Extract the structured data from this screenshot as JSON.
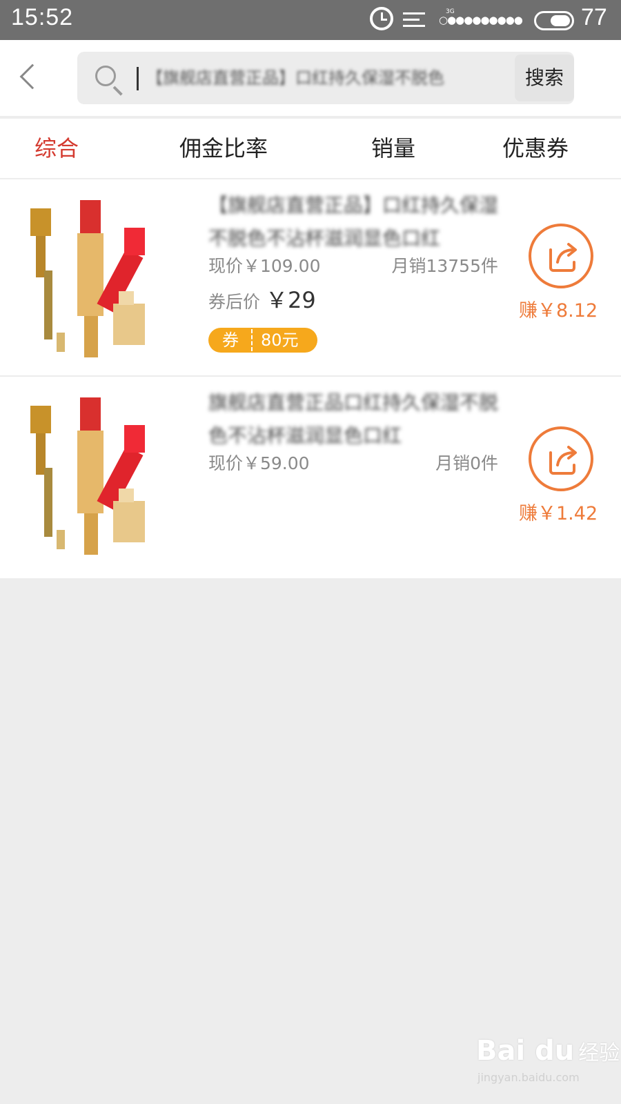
{
  "status_bar": {
    "time": "15:52",
    "network": "3G",
    "signal_dots": "○●●●●●●●●●",
    "battery": "77"
  },
  "search": {
    "value": "【旗舰店直营正品】口红持久保湿不脱色",
    "button_label": "搜索"
  },
  "sort_tabs": [
    {
      "label": "综合",
      "active": true
    },
    {
      "label": "佣金比率",
      "active": false
    },
    {
      "label": "销量",
      "active": false
    },
    {
      "label": "优惠券",
      "active": false
    }
  ],
  "products": [
    {
      "title": "【旗舰店直营正品】口红持久保湿不脱色不沾杯滋润显色口红",
      "price_now": "现价￥109.00",
      "monthly_sales": "月销13755件",
      "after_coupon_label": "券后价",
      "after_coupon_price": "￥29",
      "coupon_tag": "券",
      "coupon_value": "80元",
      "earn": "赚￥8.12"
    },
    {
      "title": "旗舰店直营正品口红持久保湿不脱色不沾杯滋润显色口红",
      "price_now": "现价￥59.00",
      "monthly_sales": "月销0件",
      "earn": "赚￥1.42"
    }
  ],
  "watermark": {
    "logo": "Bai du",
    "cn": "经验",
    "url": "jingyan.baidu.com"
  },
  "colors": {
    "accent_red": "#d43a2f",
    "earn_orange": "#ee7b3a",
    "coupon_yellow": "#f6a81c",
    "status_bar_bg": "#6f6f6f"
  },
  "icons": [
    "back-icon",
    "search-icon",
    "alarm-icon",
    "menu-icon",
    "share-icon",
    "lipstick-thumbnail"
  ]
}
